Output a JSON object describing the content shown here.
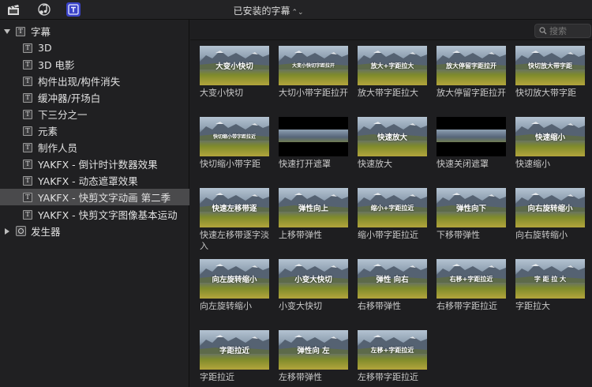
{
  "toolbar": {
    "buttons": [
      {
        "name": "libraries-button",
        "icon": "clapper-icon"
      },
      {
        "name": "photos-audio-button",
        "icon": "music-photo-icon"
      },
      {
        "name": "titles-generators-button",
        "icon": "titles-icon",
        "active": true
      }
    ],
    "title": "已安装的字幕",
    "title_chevron": "⌃⌄"
  },
  "search": {
    "placeholder": "搜索",
    "value": ""
  },
  "sidebar": {
    "items": [
      {
        "label": "字幕",
        "kind": "group-open"
      },
      {
        "label": "3D",
        "kind": "title"
      },
      {
        "label": "3D 电影",
        "kind": "title"
      },
      {
        "label": "构件出现/构件消失",
        "kind": "title"
      },
      {
        "label": "缓冲器/开场白",
        "kind": "title"
      },
      {
        "label": "下三分之一",
        "kind": "title"
      },
      {
        "label": "元素",
        "kind": "title"
      },
      {
        "label": "制作人员",
        "kind": "title"
      },
      {
        "label": "YAKFX - 倒计时计数器效果",
        "kind": "title"
      },
      {
        "label": "YAKFX - 动态遮罩效果",
        "kind": "title"
      },
      {
        "label": "YAKFX - 快剪文字动画 第二季",
        "kind": "title",
        "selected": true
      },
      {
        "label": "YAKFX - 快剪文字图像基本运动",
        "kind": "title"
      },
      {
        "label": "发生器",
        "kind": "group-closed"
      }
    ]
  },
  "tiles": [
    {
      "label": "大变小快切",
      "caption": "大变小快切"
    },
    {
      "label": "大切小带字距拉开",
      "caption": "大变小快切字距拉开"
    },
    {
      "label": "放大带字距拉大",
      "caption": "放大+字距拉大"
    },
    {
      "label": "放大停留字距拉开",
      "caption": "放大停留字距拉开"
    },
    {
      "label": "快切放大带字距",
      "caption": "快切放大带字距"
    },
    {
      "label": "快切缩小带字距",
      "caption": "快切缩小带字距拉近"
    },
    {
      "label": "快速打开遮罩",
      "caption": "",
      "dark": true
    },
    {
      "label": "快速放大",
      "caption": "快速放大"
    },
    {
      "label": "快速关闭遮罩",
      "caption": "",
      "dark": true
    },
    {
      "label": "快速缩小",
      "caption": "快速缩小"
    },
    {
      "label": "快速左移带逐字淡入",
      "caption": "快速左移带逐"
    },
    {
      "label": "上移带弹性",
      "caption": "弹性向上"
    },
    {
      "label": "缩小带字距拉近",
      "caption": "缩小+字距拉近"
    },
    {
      "label": "下移带弹性",
      "caption": "弹性向下"
    },
    {
      "label": "向右旋转缩小",
      "caption": "向右旋转缩小"
    },
    {
      "label": "向左旋转缩小",
      "caption": "向左旋转缩小"
    },
    {
      "label": "小变大快切",
      "caption": "小变大快切"
    },
    {
      "label": "右移带弹性",
      "caption": "弹性 向右"
    },
    {
      "label": "右移带字距拉近",
      "caption": "右移+字距拉近"
    },
    {
      "label": "字距拉大",
      "caption": "字 距 拉 大"
    },
    {
      "label": "字距拉近",
      "caption": "字距拉近"
    },
    {
      "label": "左移带弹性",
      "caption": "弹性向 左"
    },
    {
      "label": "左移带字距拉近",
      "caption": "左移+字距拉近"
    }
  ]
}
